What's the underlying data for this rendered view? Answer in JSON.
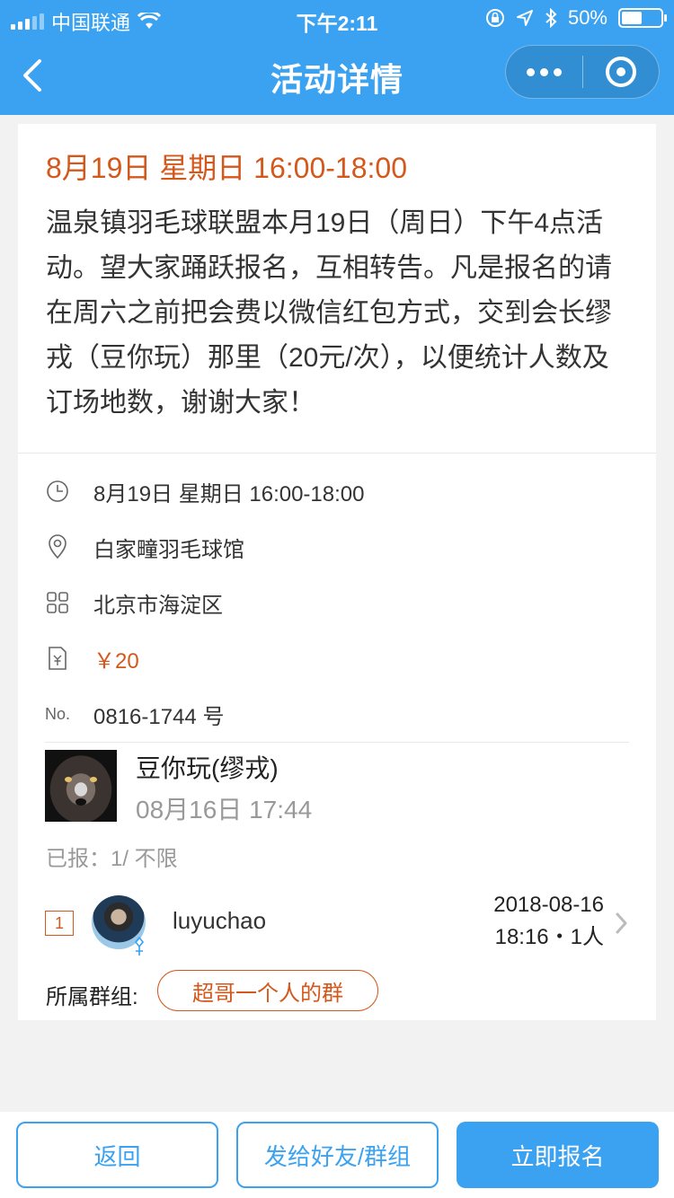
{
  "status_bar": {
    "carrier": "中国联通",
    "time": "下午2:11",
    "battery": "50%"
  },
  "nav": {
    "title": "活动详情",
    "icons": [
      "back-chevron-icon",
      "more-dots-icon",
      "close-target-icon"
    ]
  },
  "event": {
    "headline": "8月19日 星期日 16:00-18:00",
    "description": "温泉镇羽毛球联盟本月19日（周日）下午4点活动。望大家踊跃报名，互相转告。凡是报名的请在周六之前把会费以微信红包方式，交到会长缪戎（豆你玩）那里（20元/次），以便统计人数及订场地数，谢谢大家！",
    "details": {
      "time": "8月19日 星期日 16:00-18:00",
      "venue": "白家疃羽毛球馆",
      "district": "北京市海淀区",
      "price": "￥20",
      "no_label": "No.",
      "number": "0816-1744 号"
    },
    "accent_color": "#d4581c"
  },
  "organizer": {
    "name": "豆你玩(缪戎)",
    "time": "08月16日 17:44"
  },
  "signup": {
    "summary": "已报：1/ 不限",
    "entries": [
      {
        "rank": "1",
        "username": "luyuchao",
        "date": "2018-08-16",
        "time_count": "18:16・1人"
      }
    ],
    "group_label": "所属群组:",
    "group_name": "超哥一个人的群"
  },
  "bottom": {
    "back": "返回",
    "share": "发给好友/群组",
    "register": "立即报名"
  },
  "colors": {
    "primary": "#3aa2f1",
    "accent": "#d4581c",
    "background": "#f2f2f2"
  }
}
